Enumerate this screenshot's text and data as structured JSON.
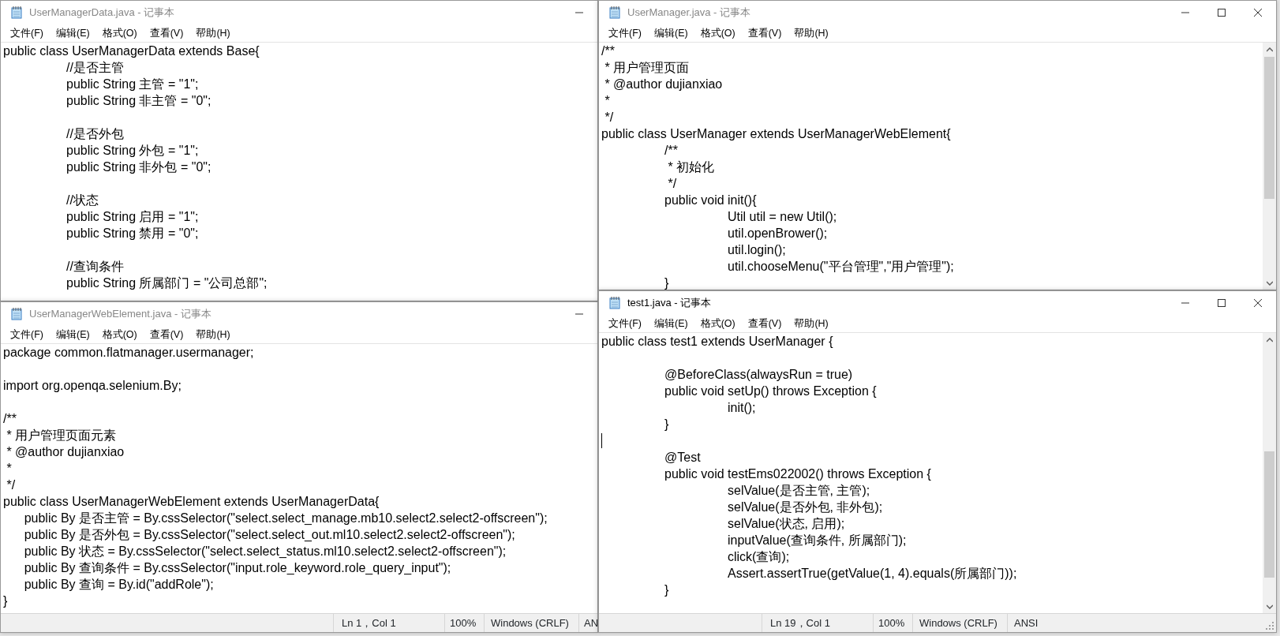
{
  "windows": [
    {
      "title": "UserManagerData.java - 记事本",
      "active": false,
      "covered_right": true,
      "menu": [
        "文件(F)",
        "编辑(E)",
        "格式(O)",
        "查看(V)",
        "帮助(H)"
      ],
      "lines": [
        {
          "text": "public class UserManagerData extends Base{"
        },
        {
          "text": "\t//是否主管"
        },
        {
          "text": "\tpublic String 主管 = \"1\";"
        },
        {
          "text": "\tpublic String 非主管 = \"0\";"
        },
        {
          "kind": "blank"
        },
        {
          "text": "\t//是否外包"
        },
        {
          "text": "\tpublic String 外包 = \"1\";"
        },
        {
          "text": "\tpublic String 非外包 = \"0\";"
        },
        {
          "kind": "blank"
        },
        {
          "text": "\t//状态"
        },
        {
          "text": "\tpublic String 启用 = \"1\";"
        },
        {
          "text": "\tpublic String 禁用 = \"0\";"
        },
        {
          "kind": "blank"
        },
        {
          "text": "\t//查询条件"
        },
        {
          "text": "\tpublic String 所属部门 = \"公司总部\";"
        }
      ]
    },
    {
      "title": "UserManagerWebElement.java - 记事本",
      "active": false,
      "covered_right": true,
      "menu": [
        "文件(F)",
        "编辑(E)",
        "格式(O)",
        "查看(V)",
        "帮助(H)"
      ],
      "lines": [
        {
          "text": "package common.flatmanager.usermanager;"
        },
        {
          "kind": "blank"
        },
        {
          "text": "import org.openqa.selenium.By;"
        },
        {
          "kind": "blank"
        },
        {
          "text": "/**"
        },
        {
          "text": " * 用户管理页面元素"
        },
        {
          "text": " * @author dujianxiao"
        },
        {
          "text": " *"
        },
        {
          "text": " */"
        },
        {
          "text": "public class UserManagerWebElement extends UserManagerData{"
        },
        {
          "text": "      public By 是否主管 = By.cssSelector(\"select.select_manage.mb10.select2.select2-offscreen\");"
        },
        {
          "text": "      public By 是否外包 = By.cssSelector(\"select.select_out.ml10.select2.select2-offscreen\");"
        },
        {
          "text": "      public By 状态 = By.cssSelector(\"select.select_status.ml10.select2.select2-offscreen\");"
        },
        {
          "text": "      public By 查询条件 = By.cssSelector(\"input.role_keyword.role_query_input\");"
        },
        {
          "text": "      public By 查询 = By.id(\"addRole\");"
        },
        {
          "text": "}"
        }
      ],
      "status_bar": {
        "position": "Ln 1，Col 1",
        "zoom": "100%",
        "line_ending": "Windows (CRLF)",
        "encoding": "AN"
      }
    },
    {
      "title": "UserManager.java - 记事本",
      "active": false,
      "covered_right": false,
      "menu": [
        "文件(F)",
        "编辑(E)",
        "格式(O)",
        "查看(V)",
        "帮助(H)"
      ],
      "lines": [
        {
          "text": "/**"
        },
        {
          "text": " * 用户管理页面"
        },
        {
          "text": " * @author dujianxiao"
        },
        {
          "text": " *"
        },
        {
          "text": " */"
        },
        {
          "text": "public class UserManager extends UserManagerWebElement{"
        },
        {
          "text": "\t/**"
        },
        {
          "text": "\t * 初始化"
        },
        {
          "text": "\t */"
        },
        {
          "text": "\tpublic void init(){"
        },
        {
          "text": "\t\tUtil util = new Util();"
        },
        {
          "text": "\t\tutil.openBrower();"
        },
        {
          "text": "\t\tutil.login();"
        },
        {
          "text": "\t\tutil.chooseMenu(\"平台管理\",\"用户管理\");"
        },
        {
          "text": "\t}"
        }
      ]
    },
    {
      "title": "test1.java - 记事本",
      "active": true,
      "covered_right": false,
      "menu": [
        "文件(F)",
        "编辑(E)",
        "格式(O)",
        "查看(V)",
        "帮助(H)"
      ],
      "lines": [
        {
          "text": "public class test1 extends UserManager {"
        },
        {
          "kind": "blank"
        },
        {
          "text": "\t@BeforeClass(alwaysRun = true)"
        },
        {
          "text": "\tpublic void setUp() throws Exception {"
        },
        {
          "text": "\t\tinit();"
        },
        {
          "text": "\t}"
        },
        {
          "kind": "blank",
          "cursor": true
        },
        {
          "text": "\t@Test"
        },
        {
          "text": "\tpublic void testEms022002() throws Exception {"
        },
        {
          "text": "\t\tselValue(是否主管, 主管);"
        },
        {
          "text": "\t\tselValue(是否外包, 非外包);"
        },
        {
          "text": "\t\tselValue(状态, 启用);"
        },
        {
          "text": "\t\tinputValue(查询条件, 所属部门);"
        },
        {
          "text": "\t\tclick(查询);"
        },
        {
          "text": "\t\tAssert.assertTrue(getValue(1, 4).equals(所属部门));"
        },
        {
          "text": "\t}"
        }
      ],
      "status_bar": {
        "position": "Ln 19，Col 1",
        "zoom": "100%",
        "line_ending": "Windows (CRLF)",
        "encoding": "ANSI"
      }
    }
  ]
}
